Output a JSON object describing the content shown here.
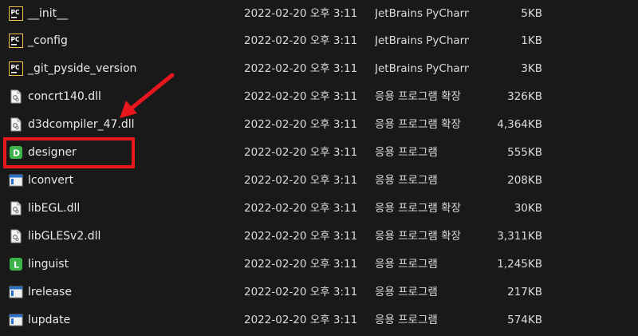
{
  "files": [
    {
      "name": "__init__",
      "date": "2022-02-20 오후 3:11",
      "type": "JetBrains PyCharm",
      "size": "5KB",
      "icon": "pycharm-icon"
    },
    {
      "name": "_config",
      "date": "2022-02-20 오후 3:11",
      "type": "JetBrains PyCharm",
      "size": "1KB",
      "icon": "pycharm-icon"
    },
    {
      "name": "_git_pyside_version",
      "date": "2022-02-20 오후 3:11",
      "type": "JetBrains PyCharm",
      "size": "3KB",
      "icon": "pycharm-icon"
    },
    {
      "name": "concrt140.dll",
      "date": "2022-02-20 오후 3:11",
      "type": "응용 프로그램 확장",
      "size": "326KB",
      "icon": "dll-file-icon"
    },
    {
      "name": "d3dcompiler_47.dll",
      "date": "2022-02-20 오후 3:11",
      "type": "응용 프로그램 확장",
      "size": "4,364KB",
      "icon": "dll-file-icon"
    },
    {
      "name": "designer",
      "date": "2022-02-20 오후 3:11",
      "type": "응용 프로그램",
      "size": "555KB",
      "icon": "qt-designer-icon"
    },
    {
      "name": "lconvert",
      "date": "2022-02-20 오후 3:11",
      "type": "응용 프로그램",
      "size": "208KB",
      "icon": "exe-window-icon"
    },
    {
      "name": "libEGL.dll",
      "date": "2022-02-20 오후 3:11",
      "type": "응용 프로그램 확장",
      "size": "30KB",
      "icon": "dll-file-icon"
    },
    {
      "name": "libGLESv2.dll",
      "date": "2022-02-20 오후 3:11",
      "type": "응용 프로그램 확장",
      "size": "3,311KB",
      "icon": "dll-file-icon"
    },
    {
      "name": "linguist",
      "date": "2022-02-20 오후 3:11",
      "type": "응용 프로그램",
      "size": "1,245KB",
      "icon": "qt-linguist-icon"
    },
    {
      "name": "lrelease",
      "date": "2022-02-20 오후 3:11",
      "type": "응용 프로그램",
      "size": "217KB",
      "icon": "exe-window-icon"
    },
    {
      "name": "lupdate",
      "date": "2022-02-20 오후 3:11",
      "type": "응용 프로그램",
      "size": "574KB",
      "icon": "exe-window-icon"
    }
  ],
  "colors": {
    "background": "#191919",
    "highlight": "#e8171d",
    "pycharm_bg": "#111111",
    "designer_green": "#3cb44a",
    "exe_blue": "#2a6fc9"
  }
}
